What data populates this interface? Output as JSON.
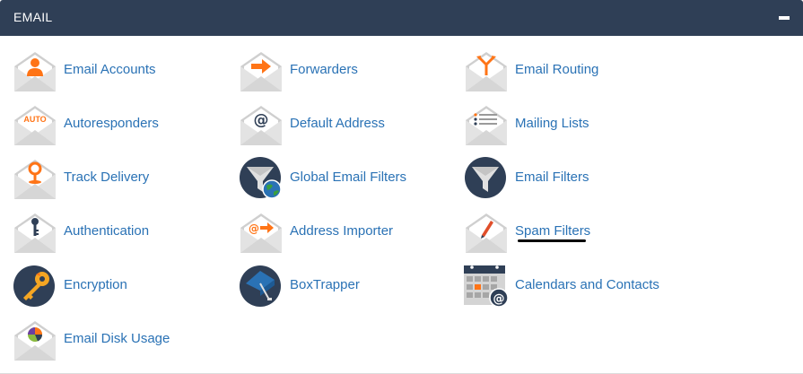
{
  "panel": {
    "title": "EMAIL",
    "collapse_icon": "minus-icon"
  },
  "colors": {
    "header_bg": "#2f3f56",
    "link": "#2a72b5",
    "accent_orange": "#ff7416",
    "icon_dark": "#2f3f56",
    "envelope_grey": "#c9c9c9"
  },
  "items": [
    {
      "label": "Email Accounts",
      "icon": "user-envelope-icon"
    },
    {
      "label": "Forwarders",
      "icon": "arrow-envelope-icon"
    },
    {
      "label": "Email Routing",
      "icon": "routing-envelope-icon"
    },
    {
      "label": "Autoresponders",
      "icon": "auto-envelope-icon",
      "icon_text": "AUTO"
    },
    {
      "label": "Default Address",
      "icon": "at-envelope-icon"
    },
    {
      "label": "Mailing Lists",
      "icon": "list-envelope-icon"
    },
    {
      "label": "Track Delivery",
      "icon": "pin-envelope-icon"
    },
    {
      "label": "Global Email Filters",
      "icon": "funnel-globe-icon"
    },
    {
      "label": "Email Filters",
      "icon": "funnel-icon"
    },
    {
      "label": "Authentication",
      "icon": "key-envelope-icon"
    },
    {
      "label": "Address Importer",
      "icon": "import-envelope-icon"
    },
    {
      "label": "Spam Filters",
      "icon": "pen-envelope-icon"
    },
    {
      "label": "Encryption",
      "icon": "gold-key-icon"
    },
    {
      "label": "BoxTrapper",
      "icon": "box-trap-icon"
    },
    {
      "label": "Calendars and Contacts",
      "icon": "calendar-icon"
    },
    {
      "label": "Email Disk Usage",
      "icon": "pie-envelope-icon"
    }
  ]
}
